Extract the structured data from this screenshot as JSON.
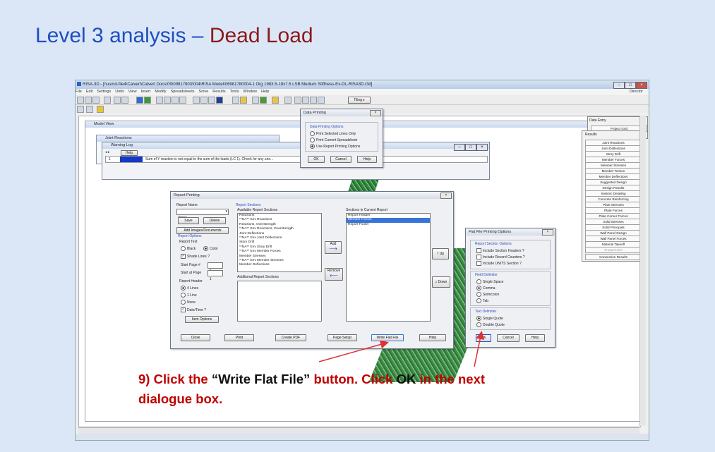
{
  "slide": {
    "title_prefix": "Level 3 analysis  – ",
    "title_suffix": "Dead Load",
    "caption_num": "9) Click the ",
    "caption_q1": "“Write Flat File”",
    "caption_mid": " button. Click ",
    "caption_ok": "OK",
    "caption_end": " in the next",
    "caption_line2": "dialogue box."
  },
  "app": {
    "window_title": "RISA-3D - [\\\\usmd-file4\\Calvert\\Calvert Docs\\09\\09817803\\004\\RISA Model\\06981780004-1 Org 1983.5-18x7.5 LSB Medium Stiffness-Ex-DL-RISA3D.r3d]",
    "window_title_highlight": "Org 1983.5-18x7.5 LSB Medium Stiffness-Ex-DL-RISA3D.r3d]",
    "menu": [
      "File",
      "Edit",
      "Settings",
      "Units",
      "View",
      "Insert",
      "Modify",
      "Spreadsheets",
      "Solve",
      "Results",
      "Tools",
      "Window",
      "Help"
    ],
    "toolbar_tiling": "Tiling",
    "directory": "Director",
    "model_view": "Model View"
  },
  "joint_reactions": {
    "title": "Joint Reactions"
  },
  "warning_log": {
    "title": "Warning Log",
    "help": "Help",
    "row_num": "1",
    "message": "Sum of Y reaction is not equal to the sum of the loads (LC 1). Check for any une..."
  },
  "data_printing": {
    "title": "Data Printing",
    "group": "Data Printing Options",
    "opt1": "Print Selected Lines Only",
    "opt2": "Print Current Spreadsheet",
    "opt3": "Use Report Printing Options",
    "ok": "OK",
    "cancel": "Cancel",
    "help": "Help"
  },
  "report_printing": {
    "title": "Report Printing",
    "report_name_label": "Report Name",
    "report_name_value": "None",
    "save": "Save",
    "delete": "Delete",
    "add_images": "Add Images/Documents",
    "report_options": "Report Options",
    "report_text": "Report Text",
    "black": "Black",
    "color": "Color",
    "shade_lines": "Shade Lines ?",
    "start_page_label": "Start Page #",
    "start_page_value": "1",
    "start_at_label": "Start at Page",
    "start_at_value": "1",
    "report_header": "Report Header",
    "h4": "4 Lines",
    "h1": "1 Line",
    "hnone": "None",
    "date_time": "Date/Time ?",
    "item_options": "Item Options",
    "sections_group": "Report Sections",
    "available_label": "Available Report Sections",
    "available": [
      "Reactions",
      "**NA** Env Reactions",
      "Reactions, Overstrength",
      "**NA** Env Reactions, Overstrength",
      "Joint Deflections",
      "**NA** Env Joint Deflections",
      "Story Drift",
      "**NA** Env Story Drift",
      "**NA** Env Member Forces",
      "Member Stresses",
      "**NA** Env Member Stresses",
      "Member Deflections"
    ],
    "additional_label": "Additional Report Sections",
    "add": "Add",
    "remove": "Remove",
    "current_label": "Sections in Current Report",
    "current": [
      "Report Header",
      "Member Forces",
      "Report Footer"
    ],
    "up": "Up",
    "down": "Down",
    "close": "Close",
    "print": "Print",
    "create_pdf": "Create PDF",
    "page_setup": "Page Setup",
    "write_flat_file": "Write Flat File",
    "help": "Help"
  },
  "flat_file": {
    "title": "Flat File Printing Options",
    "section_options": "Report Section Options",
    "include_headers": "Include Section Headers ?",
    "include_counters": "Include Record Counters ?",
    "include_units": "Include UNITS Section ?",
    "field_delim": "Field Delimiter",
    "single_space": "Single Space",
    "comma": "Comma",
    "semicolon": "Semicolon",
    "tab": "Tab",
    "text_delim": "Text Delimiter",
    "single_quote": "Single Quote",
    "double_quote": "Double Quote",
    "ok": "OK",
    "cancel": "Cancel",
    "help": "Help"
  },
  "data_entry": {
    "title": "Data Entry",
    "project_grid": "Project Grid"
  },
  "results": {
    "title": "Results",
    "items": [
      "Joint Reactions",
      "Joint Deflections",
      "Story Drift",
      "Member Forces",
      "Member Stresses",
      "Member Torsion",
      "Member Deflections",
      "Suggested Design",
      "Design Results",
      "Seismic Detailing",
      "Concrete Reinforcing",
      "Plate Stresses",
      "Plate Forces",
      "Plate Corner Forces",
      "Solid Stresses",
      "Solid Principals",
      "Wall Panel Design",
      "Wall Panel Forces",
      "Material Takeoff",
      "Frequencies",
      "Connection Results"
    ]
  },
  "colors": {
    "title_blue": "#1f4fbf",
    "title_red": "#8b1a1a",
    "caption_red": "#c00000",
    "selection": "#3875d7",
    "arrow": "#e03030"
  }
}
